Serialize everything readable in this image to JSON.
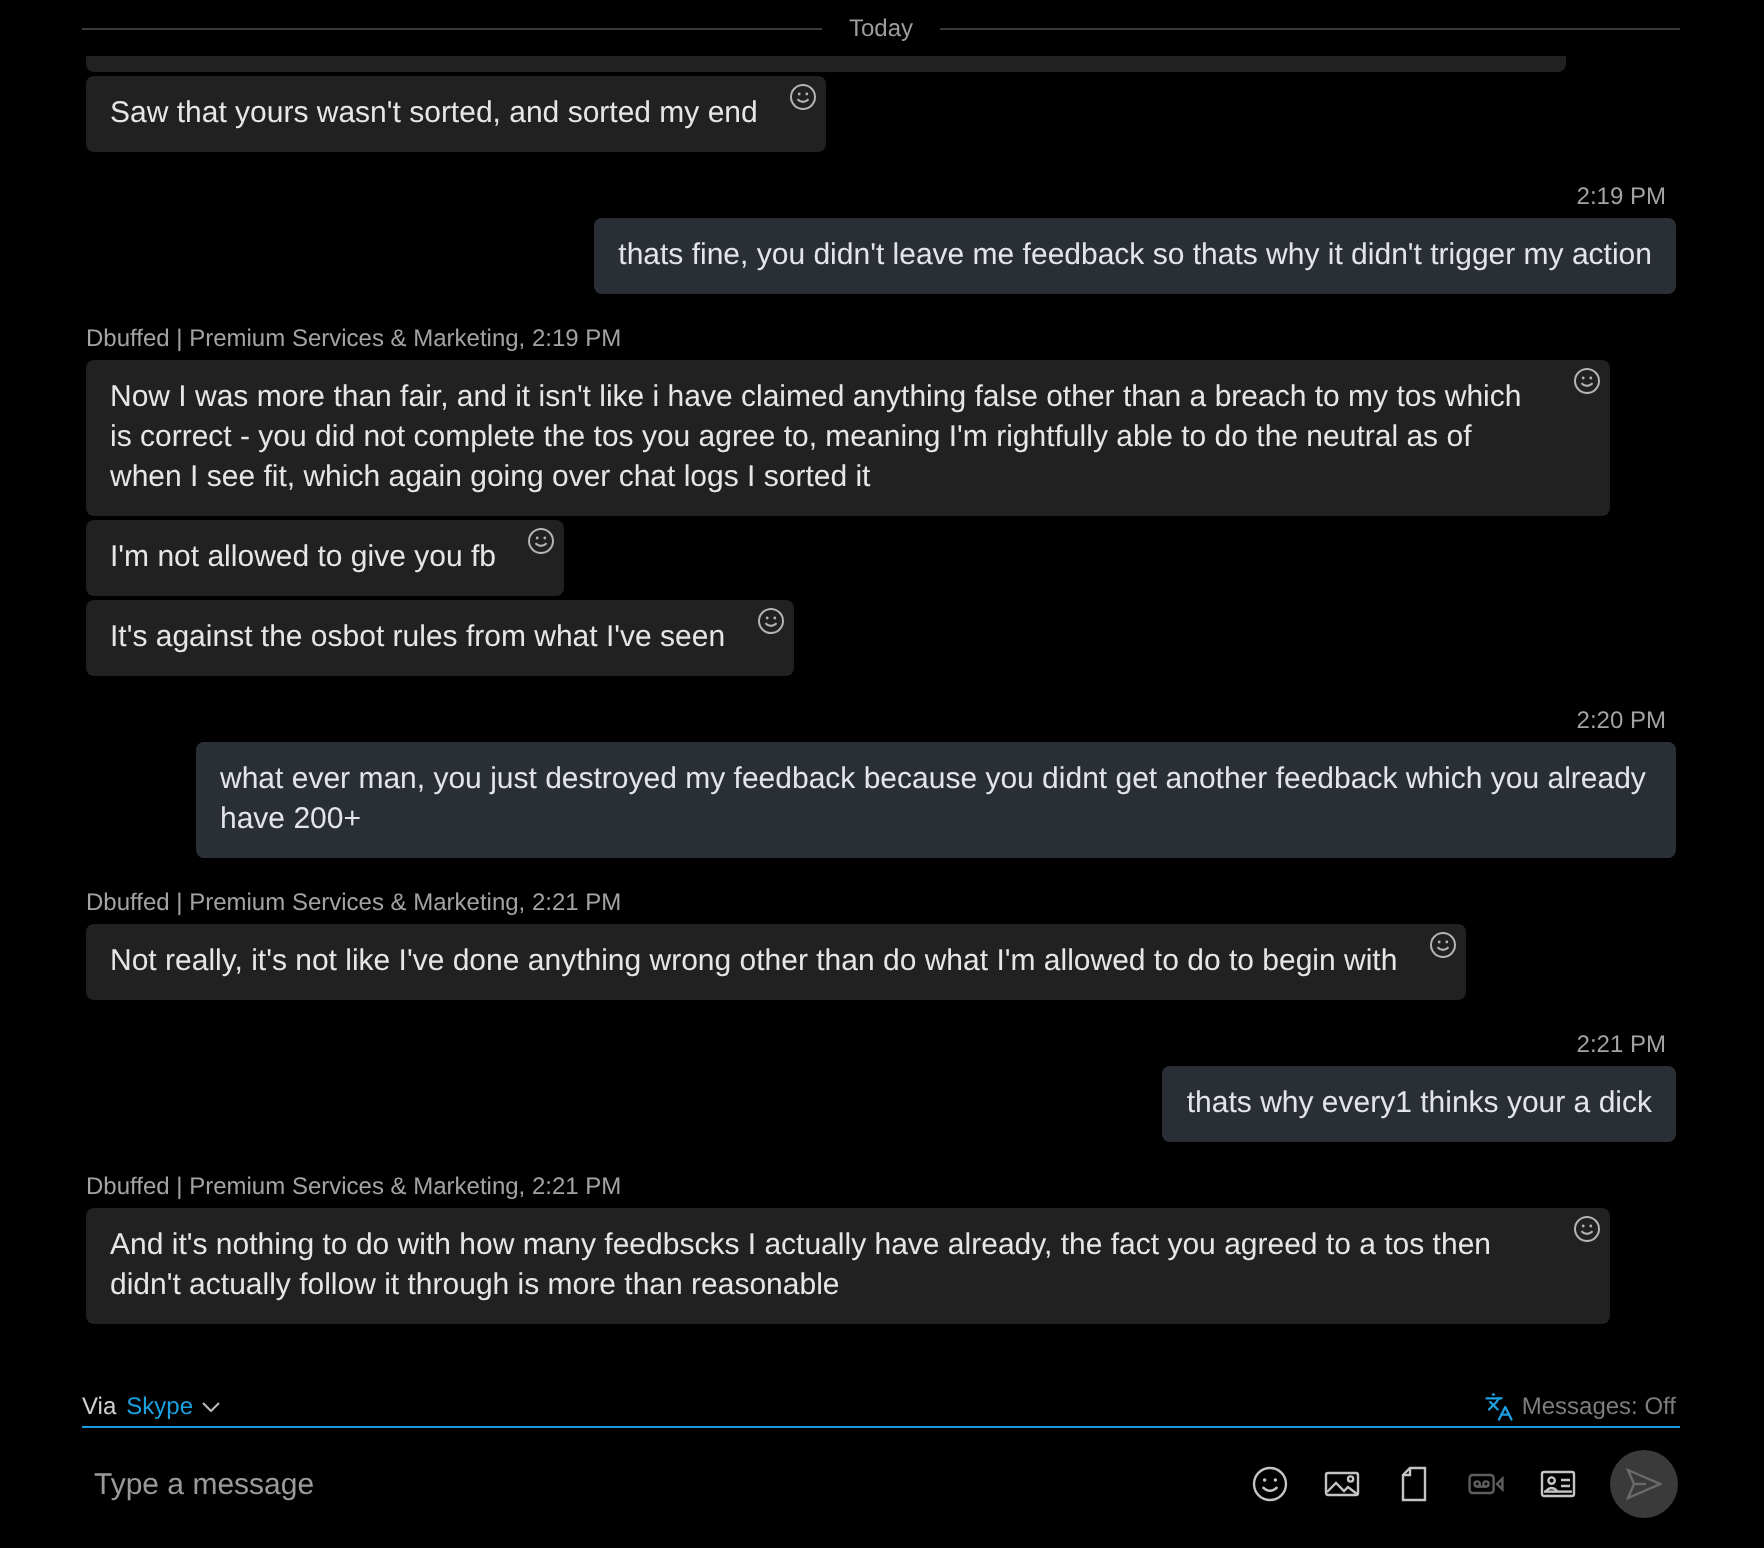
{
  "conversation": {
    "date_divider": "Today",
    "groups": [
      {
        "kind": "incoming",
        "bubbles": [
          {
            "kind": "clipped"
          },
          {
            "kind": "text",
            "text": "Saw that yours wasn't sorted, and sorted my end"
          }
        ]
      },
      {
        "kind": "outgoing",
        "header": "2:19 PM",
        "bubbles": [
          {
            "kind": "text",
            "text": "thats fine, you didn't leave me feedback so thats why it didn't trigger my action"
          }
        ]
      },
      {
        "kind": "incoming",
        "header": "Dbuffed | Premium Services & Marketing, 2:19 PM",
        "bubbles": [
          {
            "kind": "text",
            "text": "Now I was more than fair, and it isn't like i have claimed anything false other than a breach to my tos which is correct - you did not complete the tos you agree to, meaning I'm rightfully able to do the neutral as of when I see fit, which again going over chat logs I sorted it"
          },
          {
            "kind": "text",
            "text": "I'm not allowed to give you fb"
          },
          {
            "kind": "text",
            "text": "It's against the osbot rules from what I've seen"
          }
        ]
      },
      {
        "kind": "outgoing",
        "header": "2:20 PM",
        "bubbles": [
          {
            "kind": "text",
            "text": "what ever man, you just destroyed my feedback because you didnt get another feedback which you already have 200+"
          }
        ]
      },
      {
        "kind": "incoming",
        "header": "Dbuffed | Premium Services & Marketing, 2:21 PM",
        "bubbles": [
          {
            "kind": "text",
            "text": "Not really, it's not like I've done anything wrong other than do what I'm allowed to do to begin with"
          }
        ]
      },
      {
        "kind": "outgoing",
        "header": "2:21 PM",
        "bubbles": [
          {
            "kind": "text",
            "text": "thats why every1 thinks your a dick"
          }
        ]
      },
      {
        "kind": "incoming",
        "header": "Dbuffed | Premium Services & Marketing, 2:21 PM",
        "bubbles": [
          {
            "kind": "text",
            "text": "And it's nothing to do with how many feedbscks I actually have already, the fact you agreed to a tos then didn't actually follow it through is more than reasonable"
          }
        ]
      }
    ]
  },
  "composer": {
    "via_label": "Via",
    "service": "Skype",
    "translation_status": "Messages: Off",
    "placeholder": "Type a message",
    "tools": [
      {
        "kind": "emoji",
        "disabled": false
      },
      {
        "kind": "image",
        "disabled": false
      },
      {
        "kind": "file",
        "disabled": false
      },
      {
        "kind": "video_message",
        "disabled": true
      },
      {
        "kind": "contact",
        "disabled": false
      }
    ],
    "send": {
      "disabled": true
    }
  }
}
